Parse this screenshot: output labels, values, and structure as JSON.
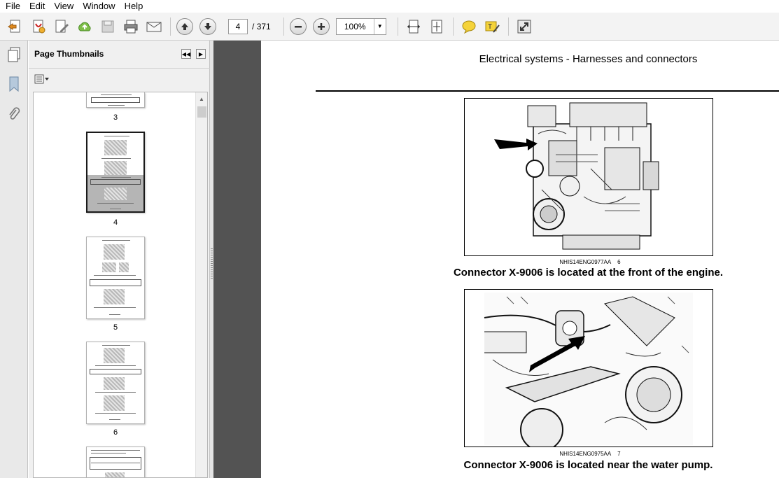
{
  "menu": [
    "File",
    "Edit",
    "View",
    "Window",
    "Help"
  ],
  "toolbar": {
    "page_current": "4",
    "page_separator": "/",
    "page_total": "371",
    "zoom": "100%"
  },
  "panel": {
    "title": "Page Thumbnails",
    "thumbnails": [
      {
        "label": "3"
      },
      {
        "label": "4"
      },
      {
        "label": "5"
      },
      {
        "label": "6"
      }
    ]
  },
  "document": {
    "header": "Electrical systems - Harnesses and connectors",
    "figures": [
      {
        "id": "NHIS14ENG0977AA",
        "num": "6",
        "caption": "Connector X-9006 is located at the front of the engine."
      },
      {
        "id": "NHIS14ENG0975AA",
        "num": "7",
        "caption": "Connector X-9006 is located near the water pump."
      }
    ]
  },
  "colors": {
    "doc_background": "#535353",
    "toolbar": "#f3f3f3",
    "panel": "#f0f0f0"
  }
}
